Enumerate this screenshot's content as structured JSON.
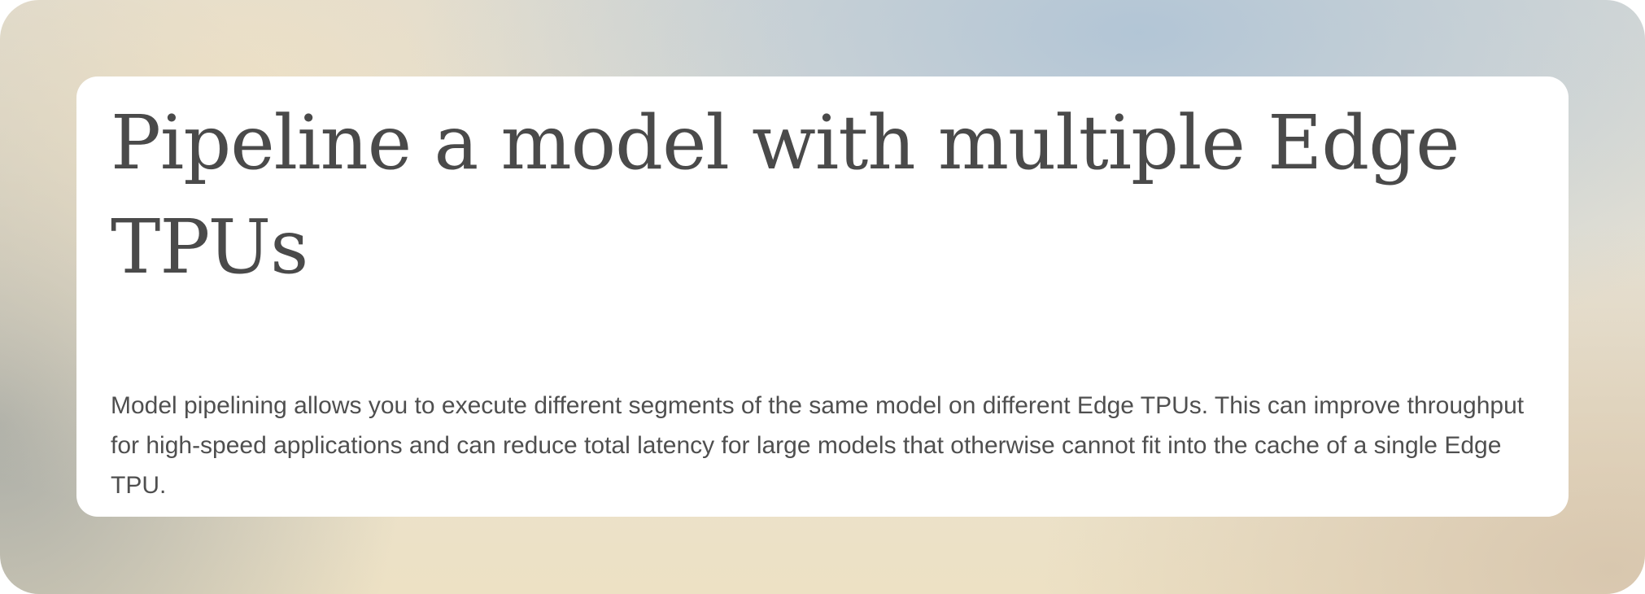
{
  "page": {
    "title": "Pipeline a model with multiple Edge TPUs",
    "summary": "Model pipelining allows you to execute different segments of the same model on different Edge TPUs. This can improve throughput for high-speed applications and can reduce total latency for large models that otherwise cannot fit into the cache of a single Edge TPU."
  },
  "colors": {
    "title_text": "#4a4a4a",
    "body_text": "#4f4f4f",
    "card_background": "#ffffff"
  }
}
